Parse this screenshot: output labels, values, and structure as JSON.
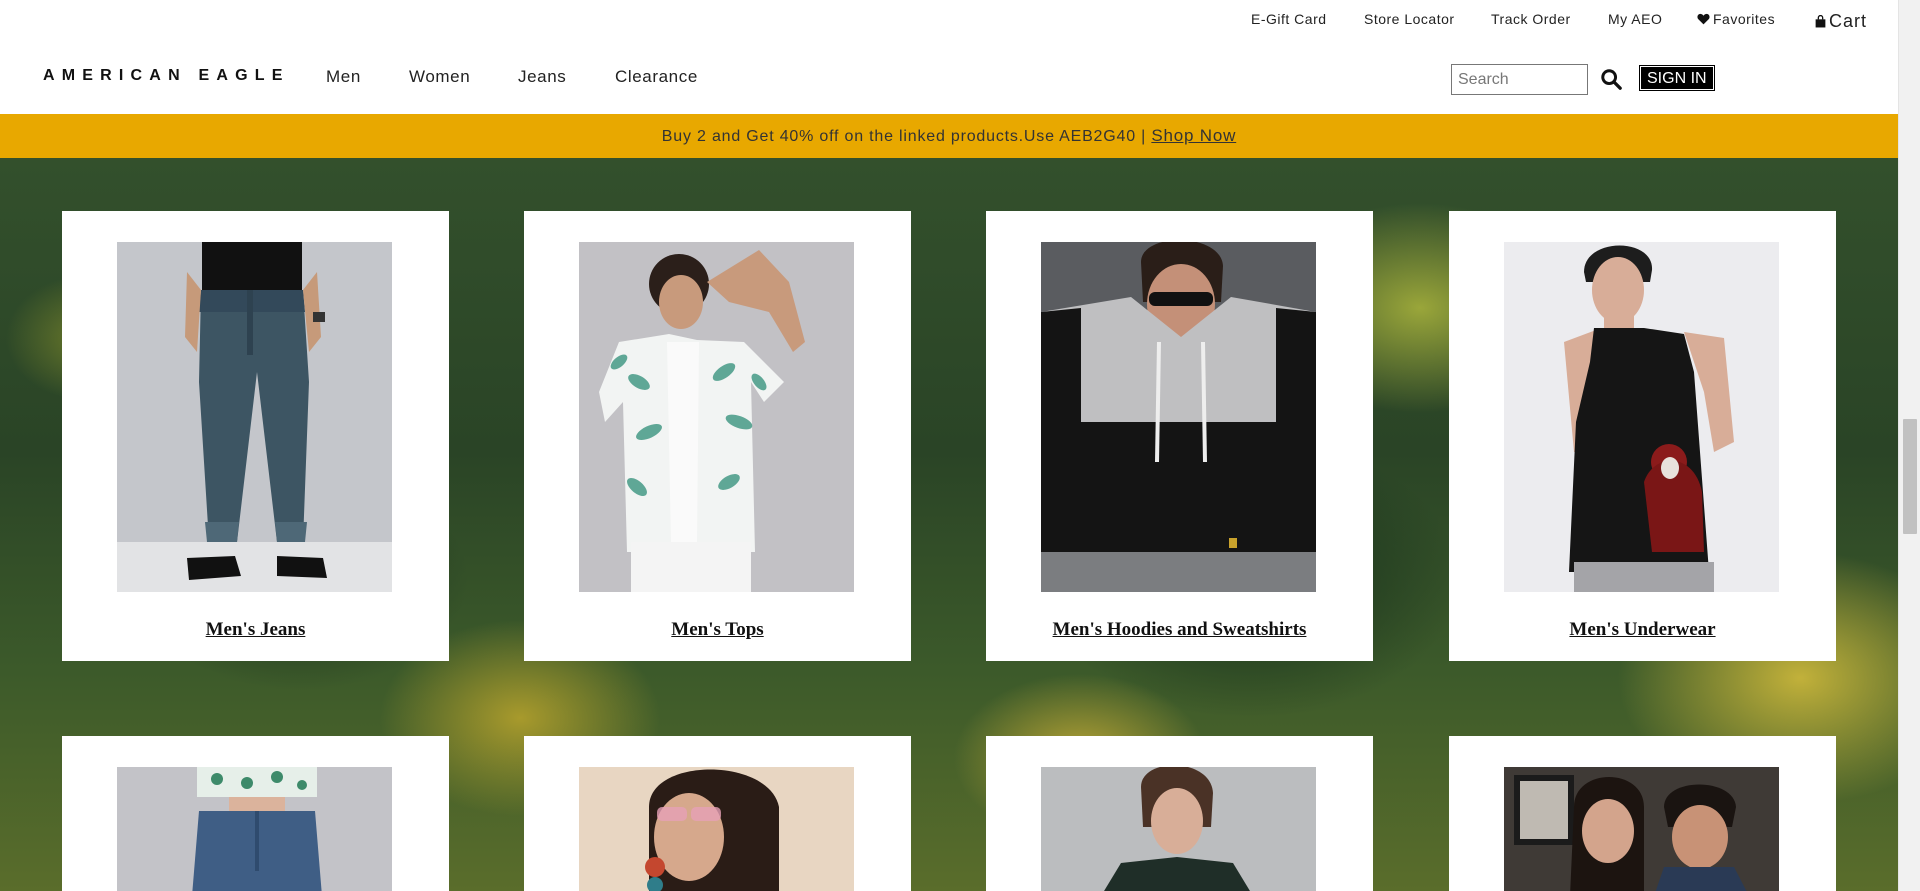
{
  "utility_nav": {
    "egift": "E-Gift Card",
    "store_locator": "Store Locator",
    "track_order": "Track Order",
    "my_aeo": "My AEO",
    "favorites": "Favorites",
    "cart": "Cart"
  },
  "header": {
    "logo": "AMERICAN EAGLE",
    "nav": [
      "Men",
      "Women",
      "Jeans",
      "Clearance"
    ],
    "search_placeholder": "Search",
    "signin": "SIGN IN"
  },
  "promo": {
    "text": "Buy 2 and Get 40% off on the linked products.Use AEB2G40 |",
    "link": "Shop Now"
  },
  "categories": [
    {
      "title": "Men's Jeans"
    },
    {
      "title": "Men's Tops"
    },
    {
      "title": "Men's Hoodies and Sweatshirts"
    },
    {
      "title": "Men's Underwear"
    }
  ],
  "colors": {
    "promo_bar": "#e8a800",
    "signin_bg": "#000000"
  }
}
